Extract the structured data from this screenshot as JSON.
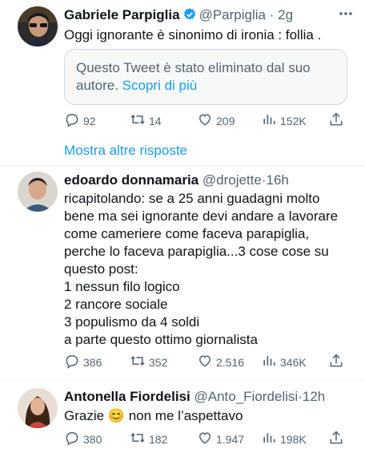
{
  "tweets": [
    {
      "name": "Gabriele Parpiglia",
      "handle": "@Parpiglia",
      "sep": "·",
      "time": "2g",
      "text_lines": [
        "Oggi ignorante è sinonimo di ironia : follia ."
      ],
      "quote": {
        "text": "Questo Tweet è stato eliminato dal suo autore.",
        "link": "Scopri di più"
      },
      "stats": {
        "replies": "92",
        "retweets": "14",
        "likes": "209",
        "views": "152K"
      }
    },
    {
      "name": "edoardo donnamaria",
      "handle": "@drojette",
      "sep": "·",
      "time": "16h",
      "text_lines": [
        "ricapitolando: se a 25 anni guadagni molto",
        "bene ma sei ignorante devi andare a lavorare",
        "come cameriere come faceva parapiglia,",
        "perche lo faceva parapiglia...3 cose cose su",
        "questo post:",
        "1 nessun filo logico",
        "2 rancore sociale",
        "3 populismo da 4 soldi",
        "a parte questo ottimo giornalista"
      ],
      "stats": {
        "replies": "386",
        "retweets": "352",
        "likes": "2.516",
        "views": "346K"
      }
    },
    {
      "name": "Antonella Fiordelisi",
      "handle": "@Anto_Fiordelisi",
      "sep": "·",
      "time": "12h",
      "text_before": "Grazie",
      "emoji": "😊",
      "text_after": "non me l’aspettavo",
      "stats": {
        "replies": "380",
        "retweets": "182",
        "likes": "1.947",
        "views": "198K"
      }
    }
  ],
  "show_more": "Mostra altre risposte",
  "colors": {
    "accent": "#1d9bf0",
    "secondary_text": "#536471",
    "border": "#cfd9de"
  },
  "icons": [
    "verified-badge-icon",
    "more-icon",
    "reply-icon",
    "retweet-icon",
    "like-icon",
    "views-icon",
    "share-icon"
  ]
}
